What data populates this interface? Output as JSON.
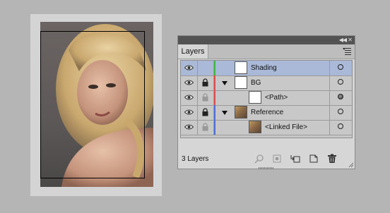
{
  "panel": {
    "tab_label": "Layers",
    "footer": {
      "layer_count_text": "3 Layers"
    }
  },
  "layers": [
    {
      "name": "Shading",
      "indent": 0,
      "color": "#3dbb3d",
      "selected": true,
      "locked": false,
      "has_disclosure": false,
      "thumb": "white",
      "target": "empty"
    },
    {
      "name": "BG",
      "indent": 0,
      "color": "#e04d4d",
      "selected": false,
      "locked": true,
      "has_disclosure": true,
      "thumb": "white",
      "target": "empty"
    },
    {
      "name": "<Path>",
      "indent": 1,
      "color": "#e04d4d",
      "selected": false,
      "locked": true,
      "has_disclosure": false,
      "thumb": "white",
      "target": "filled"
    },
    {
      "name": "Reference",
      "indent": 0,
      "color": "#4b6fd8",
      "selected": false,
      "locked": true,
      "has_disclosure": true,
      "thumb": "photo",
      "target": "empty"
    },
    {
      "name": "<Linked File>",
      "indent": 1,
      "color": "#4b6fd8",
      "selected": false,
      "locked": true,
      "has_disclosure": false,
      "thumb": "photo",
      "target": "empty"
    }
  ],
  "icons": {
    "titlebar": [
      "collapse-icon",
      "close-icon"
    ],
    "footer": [
      "locate-object-icon",
      "make-clipping-mask-icon",
      "create-sublayer-icon",
      "create-new-layer-icon",
      "delete-icon"
    ]
  }
}
